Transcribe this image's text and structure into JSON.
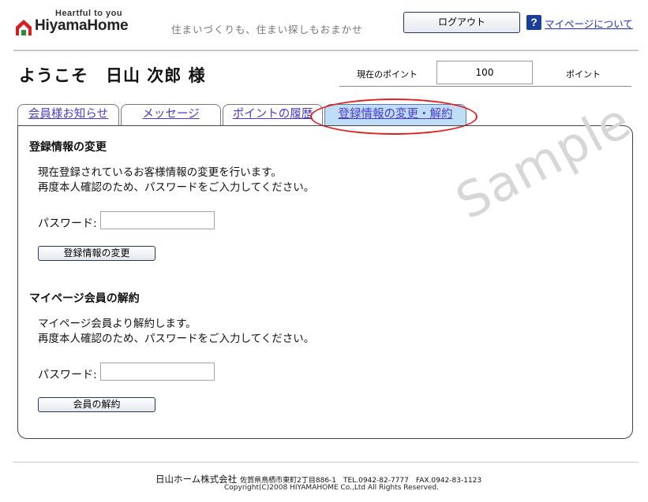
{
  "header": {
    "logo": {
      "tagline": "Heartful to you",
      "name": "HiyamaHome"
    },
    "slogan": "住まいづくりも、住まい探しもおまかせ",
    "logout_label": "ログアウト",
    "help_icon_glyph": "?",
    "help_link": "マイページについて"
  },
  "user": {
    "welcome": "ようこそ　日山 次郎 様",
    "points_label": "現在のポイント",
    "points_value": "100",
    "points_unit": "ポイント"
  },
  "tabs": [
    {
      "label": "会員様お知らせ"
    },
    {
      "label": "メッセージ"
    },
    {
      "label": "ポイントの履歴"
    },
    {
      "label": "登録情報の変更・解約",
      "active": true
    }
  ],
  "update_section": {
    "title": "登録情報の変更",
    "line1": "現在登録されているお客様情報の変更を行います。",
    "line2": "再度本人確認のため、パスワードをご入力してください。",
    "password_label": "パスワード:",
    "button_label": "登録情報の変更"
  },
  "cancel_section": {
    "title": "マイページ会員の解約",
    "line1": "マイページ会員より解約します。",
    "line2": "再度本人確認のため、パスワードをご入力してください。",
    "password_label": "パスワード:",
    "button_label": "会員の解約"
  },
  "watermark": "Sample",
  "footer": {
    "company": "日山ホーム株式会社",
    "address": "佐賀県鳥栖市東町2丁目886-1　TEL.0942-82-7777　FAX.0942-83-1123",
    "copyright": "Copyright(C)2008 HIYAMAHOME Co.,Ltd All Rights Reserved."
  },
  "colors": {
    "logo_red": "#d42020",
    "logo_green": "#2f8a3a",
    "link_blue": "#1a2fd0",
    "active_tab": "#c0ddf8",
    "highlight_oval": "#e22020"
  }
}
